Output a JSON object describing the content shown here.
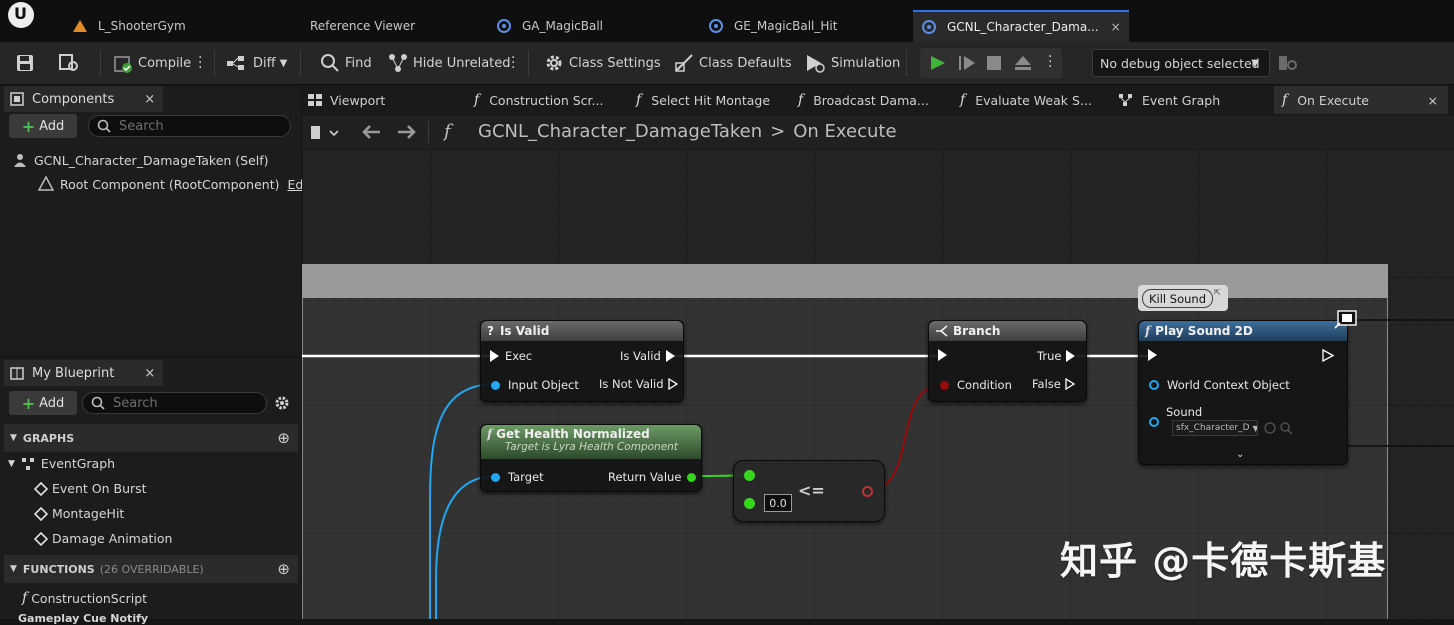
{
  "doc_tabs": [
    {
      "label": "L_ShooterGym",
      "icon": "level-icon"
    },
    {
      "label": "Reference Viewer",
      "icon": ""
    },
    {
      "label": "GA_MagicBall",
      "icon": "blueprint-icon"
    },
    {
      "label": "GE_MagicBall_Hit",
      "icon": "blueprint-icon"
    },
    {
      "label": "GCNL_Character_Dama...",
      "icon": "blueprint-icon",
      "close": "×"
    }
  ],
  "toolbar": {
    "compile": "Compile",
    "diff": "Diff",
    "find": "Find",
    "hide_unrelated": "Hide Unrelated",
    "class_settings": "Class Settings",
    "class_defaults": "Class Defaults",
    "simulation": "Simulation",
    "debug_object": "No debug object selected"
  },
  "components_panel": {
    "title": "Components",
    "close": "×",
    "add": "Add",
    "search_placeholder": "Search",
    "self_item": "GCNL_Character_DamageTaken (Self)",
    "root_item": "Root Component (RootComponent)",
    "edit_link": "Edit in"
  },
  "my_blueprint": {
    "title": "My Blueprint",
    "close": "×",
    "add": "Add",
    "search_placeholder": "Search",
    "graphs_header": "GRAPHS",
    "graphs": [
      "EventGraph",
      "Event On Burst",
      "MontageHit",
      "Damage Animation"
    ],
    "functions_header": "FUNCTIONS",
    "functions_count": "(26 OVERRIDABLE)",
    "functions": [
      "ConstructionScript",
      "Gameplay Cue Notify"
    ]
  },
  "graph_tabs": [
    {
      "label": "Viewport",
      "icon": "viewport-icon"
    },
    {
      "label": "Construction Scr...",
      "icon": "function-icon"
    },
    {
      "label": "Select Hit Montage",
      "icon": "function-icon"
    },
    {
      "label": "Broadcast Dama...",
      "icon": "function-icon"
    },
    {
      "label": "Evaluate Weak S...",
      "icon": "function-icon"
    },
    {
      "label": "Event Graph",
      "icon": "event-graph-icon"
    },
    {
      "label": "On Execute",
      "icon": "function-icon",
      "close": "×"
    }
  ],
  "breadcrumb": {
    "graph": "GCNL_Character_DamageTaken",
    "separator": ">",
    "function": "On Execute"
  },
  "nodes": {
    "is_valid": {
      "title": "Is Valid",
      "exec": "Exec",
      "is_valid": "Is Valid",
      "input": "Input Object",
      "not_valid": "Is Not Valid"
    },
    "get_health": {
      "title": "Get Health Normalized",
      "subtitle": "Target is Lyra Health Component",
      "target": "Target",
      "return": "Return Value"
    },
    "compare": {
      "operator": "<=",
      "literal": "0.0"
    },
    "branch": {
      "title": "Branch",
      "true": "True",
      "condition": "Condition",
      "false": "False"
    },
    "play_sound": {
      "title": "Play Sound 2D",
      "comment": "Kill Sound",
      "world_context": "World Context Object",
      "sound": "Sound",
      "sound_value": "sfx_Character_D"
    }
  },
  "watermark": "知乎 @卡德卡斯基",
  "colors": {
    "accent": "#2f6fe0",
    "exec_wire": "#ffffff",
    "object_pin": "#22a7f0",
    "float_pin": "#38d51e",
    "bool_pin": "#950c0c",
    "pure_node_header": "#5e8b5a",
    "function_header": "#2a5a87"
  }
}
